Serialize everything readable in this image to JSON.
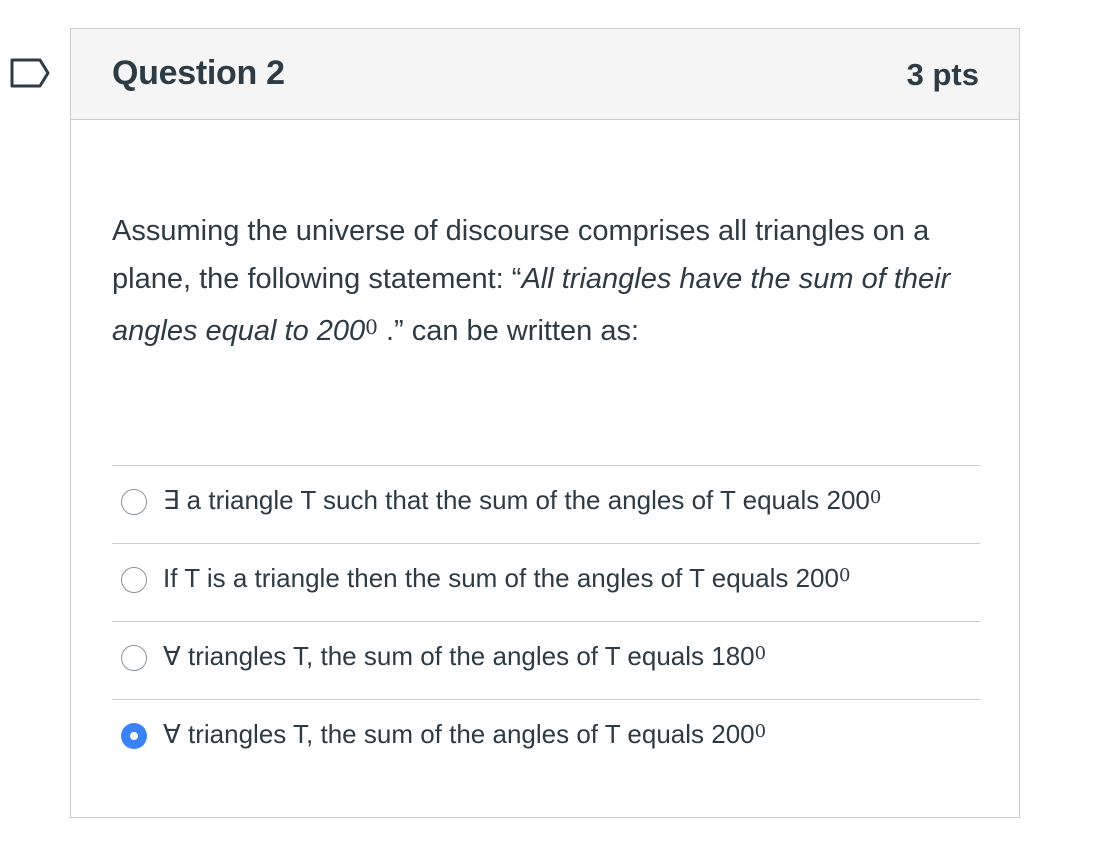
{
  "question": {
    "title": "Question 2",
    "points": "3 pts",
    "text_part1": "Assuming the universe of discourse comprises all triangles on a plane, the following statement:  “",
    "text_italic": "All triangles have the sum of their angles equal to 200",
    "text_sup": "0",
    "text_part2": " .” can be written as:"
  },
  "answers": [
    {
      "symbol": "∃",
      "label": " a triangle T such that the sum of the angles of T equals 200",
      "sup": "0",
      "selected": false
    },
    {
      "symbol": "",
      "label": "If T is a triangle then the sum of the angles of T equals 200",
      "sup": "0",
      "selected": false
    },
    {
      "symbol": "∀",
      "label": " triangles T, the sum of the angles of T equals 180",
      "sup": "0",
      "selected": false
    },
    {
      "symbol": "∀",
      "label": " triangles T, the sum of the angles of T equals 200",
      "sup": "0",
      "selected": true
    }
  ],
  "colors": {
    "accent": "#3b82f6",
    "text": "#2d3b45",
    "border": "#c7cdd1",
    "header_bg": "#f5f5f5"
  }
}
